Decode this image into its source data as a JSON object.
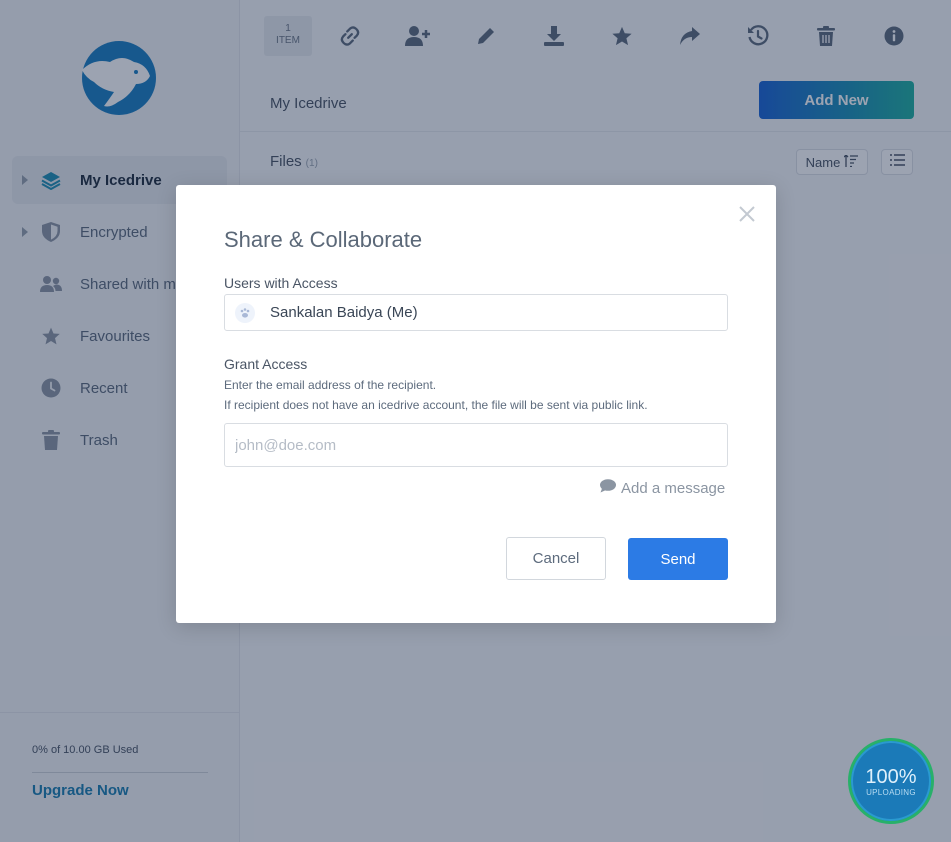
{
  "sidebar": {
    "items": [
      {
        "label": "My Icedrive",
        "icon": "layers-icon",
        "active": true
      },
      {
        "label": "Encrypted",
        "icon": "shield-icon",
        "active": false
      },
      {
        "label": "Shared with me",
        "icon": "users-icon",
        "active": false
      },
      {
        "label": "Favourites",
        "icon": "star-icon",
        "active": false
      },
      {
        "label": "Recent",
        "icon": "clock-icon",
        "active": false
      },
      {
        "label": "Trash",
        "icon": "trash-icon",
        "active": false
      }
    ],
    "storage_text": "0% of 10.00 GB Used",
    "upgrade_label": "Upgrade Now"
  },
  "toolbar": {
    "count_number": "1",
    "count_label": "ITEM",
    "icons": [
      "link-icon",
      "add-user-icon",
      "pencil-icon",
      "download-icon",
      "star-icon",
      "share-icon",
      "history-icon",
      "trash-icon",
      "info-icon"
    ]
  },
  "header": {
    "breadcrumb": "My Icedrive",
    "add_new_label": "Add New"
  },
  "files": {
    "label": "Files",
    "count": "(1)",
    "sort_label": "Name"
  },
  "modal": {
    "title": "Share & Collaborate",
    "users_label": "Users with Access",
    "user_name": "Sankalan Baidya (Me)",
    "grant_label": "Grant Access",
    "help_line1": "Enter the email address of the recipient.",
    "help_line2": "If recipient does not have an icedrive account, the file will be sent via public link.",
    "email_placeholder": "john@doe.com",
    "add_message_label": "Add a message",
    "cancel_label": "Cancel",
    "send_label": "Send"
  },
  "upload": {
    "percent": "100%",
    "label": "UPLOADING"
  },
  "colors": {
    "accent": "#2c7be5",
    "upgrade": "#1a7fb0",
    "add_new_start": "#1b64d4",
    "add_new_end": "#1fb1a0",
    "upload_ring": "#28b06a"
  }
}
